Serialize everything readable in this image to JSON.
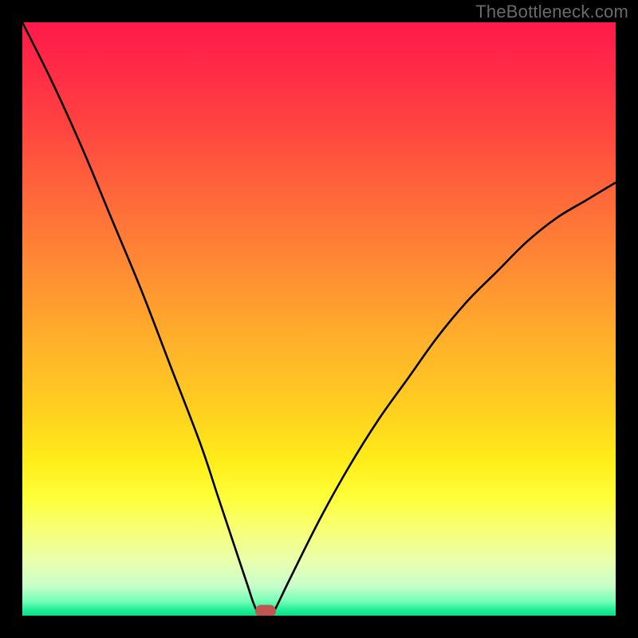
{
  "watermark": "TheBottleneck.com",
  "chart_data": {
    "type": "line",
    "title": "",
    "xlabel": "",
    "ylabel": "",
    "xlim": [
      0,
      100
    ],
    "ylim": [
      0,
      100
    ],
    "grid": false,
    "legend": false,
    "series": [
      {
        "name": "bottleneck-curve",
        "x": [
          0,
          5,
          10,
          15,
          20,
          25,
          30,
          33,
          36,
          38,
          39,
          40,
          41,
          42,
          45,
          50,
          55,
          60,
          65,
          70,
          75,
          80,
          85,
          90,
          95,
          100
        ],
        "values": [
          100,
          90,
          79,
          67,
          55,
          42,
          29,
          20,
          11,
          5,
          2,
          0,
          0,
          0,
          6,
          16,
          25,
          33,
          40,
          47,
          53,
          58,
          63,
          67,
          70,
          73
        ]
      }
    ],
    "annotations": [
      {
        "name": "optimal-marker",
        "x": 41,
        "y": 0
      }
    ],
    "background": "red-yellow-green vertical gradient"
  },
  "colors": {
    "curve": "#000000",
    "marker": "#c0564f",
    "frame": "#000000"
  }
}
